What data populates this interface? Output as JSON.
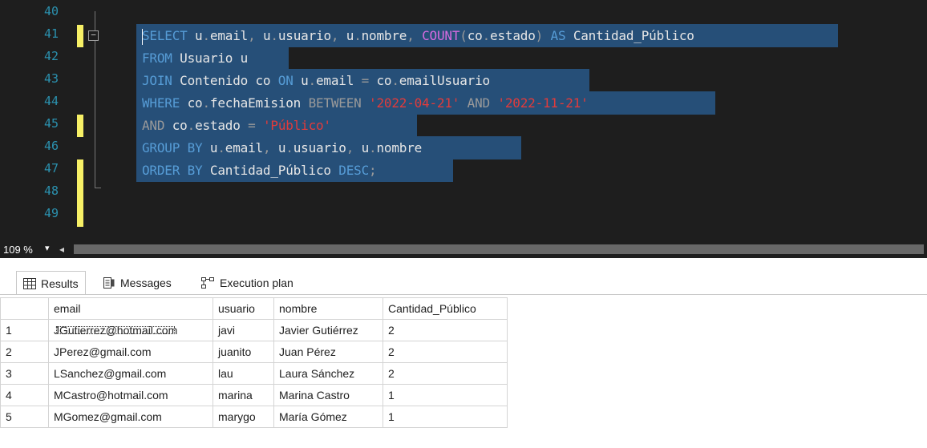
{
  "editor": {
    "line_numbers": [
      "40",
      "41",
      "42",
      "43",
      "44",
      "45",
      "46",
      "47",
      "48",
      "49"
    ],
    "code_lines": [
      [
        {
          "t": "SELECT",
          "c": "kw"
        },
        {
          "t": " u",
          "c": "id"
        },
        {
          "t": ".",
          "c": "op"
        },
        {
          "t": "email",
          "c": "id"
        },
        {
          "t": ", ",
          "c": "op"
        },
        {
          "t": "u",
          "c": "id"
        },
        {
          "t": ".",
          "c": "op"
        },
        {
          "t": "usuario",
          "c": "id"
        },
        {
          "t": ", ",
          "c": "op"
        },
        {
          "t": "u",
          "c": "id"
        },
        {
          "t": ".",
          "c": "op"
        },
        {
          "t": "nombre",
          "c": "id"
        },
        {
          "t": ", ",
          "c": "op"
        },
        {
          "t": "COUNT",
          "c": "fn"
        },
        {
          "t": "(",
          "c": "op"
        },
        {
          "t": "co",
          "c": "id"
        },
        {
          "t": ".",
          "c": "op"
        },
        {
          "t": "estado",
          "c": "id"
        },
        {
          "t": ")",
          "c": "op"
        },
        {
          "t": " AS ",
          "c": "kw"
        },
        {
          "t": "Cantidad_Público",
          "c": "id"
        }
      ],
      [
        {
          "t": "FROM",
          "c": "kw"
        },
        {
          "t": " Usuario u",
          "c": "id"
        }
      ],
      [
        {
          "t": "JOIN",
          "c": "kw"
        },
        {
          "t": " Contenido co ",
          "c": "id"
        },
        {
          "t": "ON",
          "c": "kw"
        },
        {
          "t": " u",
          "c": "id"
        },
        {
          "t": ".",
          "c": "op"
        },
        {
          "t": "email ",
          "c": "id"
        },
        {
          "t": "=",
          "c": "op"
        },
        {
          "t": " co",
          "c": "id"
        },
        {
          "t": ".",
          "c": "op"
        },
        {
          "t": "emailUsuario",
          "c": "id"
        }
      ],
      [
        {
          "t": "WHERE",
          "c": "kw"
        },
        {
          "t": " co",
          "c": "id"
        },
        {
          "t": ".",
          "c": "op"
        },
        {
          "t": "fechaEmision ",
          "c": "id"
        },
        {
          "t": "BETWEEN",
          "c": "op"
        },
        {
          "t": " ",
          "c": "id"
        },
        {
          "t": "'2022-04-21'",
          "c": "str"
        },
        {
          "t": " AND ",
          "c": "op"
        },
        {
          "t": "'2022-11-21'",
          "c": "str"
        }
      ],
      [
        {
          "t": "AND",
          "c": "op"
        },
        {
          "t": " co",
          "c": "id"
        },
        {
          "t": ".",
          "c": "op"
        },
        {
          "t": "estado ",
          "c": "id"
        },
        {
          "t": "=",
          "c": "op"
        },
        {
          "t": " ",
          "c": "id"
        },
        {
          "t": "'Público'",
          "c": "str"
        }
      ],
      [
        {
          "t": "GROUP BY",
          "c": "kw"
        },
        {
          "t": " u",
          "c": "id"
        },
        {
          "t": ".",
          "c": "op"
        },
        {
          "t": "email",
          "c": "id"
        },
        {
          "t": ", ",
          "c": "op"
        },
        {
          "t": "u",
          "c": "id"
        },
        {
          "t": ".",
          "c": "op"
        },
        {
          "t": "usuario",
          "c": "id"
        },
        {
          "t": ", ",
          "c": "op"
        },
        {
          "t": "u",
          "c": "id"
        },
        {
          "t": ".",
          "c": "op"
        },
        {
          "t": "nombre",
          "c": "id"
        }
      ],
      [
        {
          "t": "ORDER BY",
          "c": "kw"
        },
        {
          "t": " Cantidad_Público ",
          "c": "id"
        },
        {
          "t": "DESC",
          "c": "kw"
        },
        {
          "t": ";",
          "c": "op"
        }
      ]
    ]
  },
  "status": {
    "zoom": "109 %",
    "zoom_dropdown": "▾",
    "scroll_left": "◂"
  },
  "results": {
    "tabs": [
      {
        "label": "Results",
        "icon": "grid-icon"
      },
      {
        "label": "Messages",
        "icon": "messages-icon"
      },
      {
        "label": "Execution plan",
        "icon": "execution-plan-icon"
      }
    ],
    "columns": [
      "email",
      "usuario",
      "nombre",
      "Cantidad_Público"
    ],
    "rows": [
      {
        "n": "1",
        "email": "JGutierrez@hotmail.com",
        "usuario": "javi",
        "nombre": "Javier Gutiérrez",
        "cantidad": "2"
      },
      {
        "n": "2",
        "email": "JPerez@gmail.com",
        "usuario": "juanito",
        "nombre": "Juan Pérez",
        "cantidad": "2"
      },
      {
        "n": "3",
        "email": "LSanchez@gmail.com",
        "usuario": "lau",
        "nombre": "Laura Sánchez",
        "cantidad": "2"
      },
      {
        "n": "4",
        "email": "MCastro@hotmail.com",
        "usuario": "marina",
        "nombre": "Marina Castro",
        "cantidad": "1"
      },
      {
        "n": "5",
        "email": "MGomez@gmail.com",
        "usuario": "marygo",
        "nombre": "María Gómez",
        "cantidad": "1"
      }
    ]
  },
  "colors": {
    "editor_bg": "#1e1e1e",
    "selection": "#264f78",
    "keyword": "#569cd6",
    "string": "#e23b3b",
    "function": "#d66be0",
    "line_number": "#2b91af",
    "change_marker": "#f7f066"
  }
}
